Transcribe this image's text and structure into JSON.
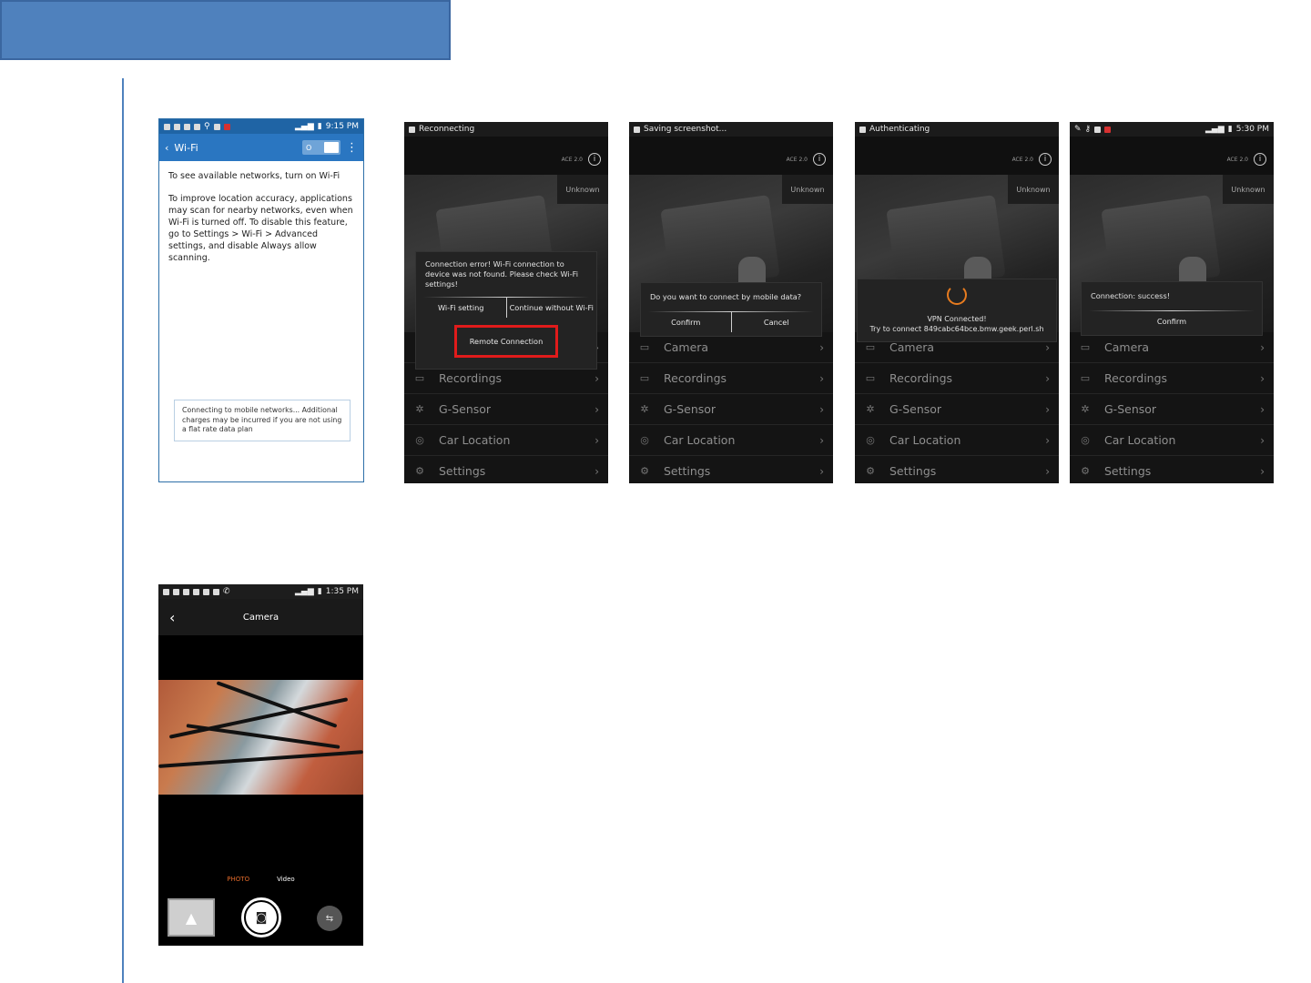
{
  "wifi": {
    "status_time": "9:15 PM",
    "title": "Wi-Fi",
    "toggle_label": "O",
    "para1": "To see available networks, turn on Wi-Fi",
    "para2": "To improve location accuracy, applications may scan for nearby networks, even when Wi-Fi is turned off. To disable this feature, go to Settings > Wi-Fi > Advanced settings, and disable Always allow scanning.",
    "notice": "Connecting to mobile networks... Additional charges may be incurred if you are not using a flat rate data plan"
  },
  "app": {
    "version": "ACE 2.0",
    "unknown_badge": "Unknown",
    "menu": [
      "Camera",
      "Recordings",
      "G-Sensor",
      "Car Location",
      "Settings"
    ]
  },
  "screen1": {
    "status_text": "Reconnecting",
    "dialog_msg": "Connection error! Wi-Fi connection to device was not found. Please check Wi-Fi settings!",
    "btn_left": "Wi-Fi setting",
    "btn_right": "Continue without Wi-Fi",
    "btn_remote": "Remote Connection"
  },
  "screen2": {
    "status_text": "Saving screenshot...",
    "dialog_msg": "Do you want to connect by mobile data?",
    "btn_confirm": "Confirm",
    "btn_cancel": "Cancel"
  },
  "screen3": {
    "status_text": "Authenticating",
    "vpn_line1": "VPN Connected!",
    "vpn_line2": "Try to connect 849cabc64bce.bmw.geek.perl.sh"
  },
  "screen4": {
    "status_time": "5:30 PM",
    "dialog_msg": "Connection: success!",
    "btn_confirm": "Confirm"
  },
  "camera": {
    "status_time": "1:35 PM",
    "title": "Camera",
    "mode_photo": "PHOTO",
    "mode_video": "Video"
  },
  "colors": {
    "header_band": "#4f81bd",
    "wifi_bar": "#2a76c1",
    "highlight_red": "#e01b1b",
    "spinner_orange": "#e77b1f",
    "photo_mode_orange": "#e0692a"
  }
}
